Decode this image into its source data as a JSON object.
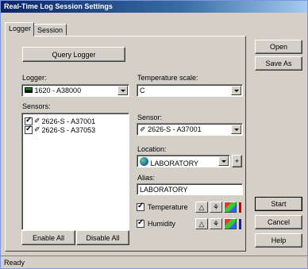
{
  "window": {
    "title": "Real-Time Log Session Settings"
  },
  "tabs": [
    {
      "label": "Logger"
    },
    {
      "label": "Session"
    }
  ],
  "query_logger": {
    "label": "Query Logger"
  },
  "logger": {
    "label": "Logger:",
    "value": "1620 - A38000"
  },
  "temp_scale": {
    "label": "Temperature scale:",
    "value": "C"
  },
  "sensors": {
    "label": "Sensors:",
    "items": [
      {
        "label": "2626-S - A37001",
        "checked": true
      },
      {
        "label": "2626-S - A37053",
        "checked": true
      }
    ],
    "enable_all": "Enable All",
    "disable_all": "Disable All"
  },
  "sensor": {
    "label": "Sensor:",
    "value": "2626-S - A37001"
  },
  "location": {
    "label": "Location:",
    "value": "LABORATORY",
    "add": "+"
  },
  "alias": {
    "label": "Alias:",
    "value": "LABORATORY"
  },
  "channels": [
    {
      "label": "Temperature",
      "checked": true,
      "color": "#cc0000"
    },
    {
      "label": "Humidity",
      "checked": true,
      "color": "#1a1aa6"
    }
  ],
  "right_buttons": {
    "open": "Open",
    "save_as": "Save As",
    "start": "Start",
    "cancel": "Cancel",
    "help": "Help"
  },
  "status": {
    "text": "Ready"
  }
}
